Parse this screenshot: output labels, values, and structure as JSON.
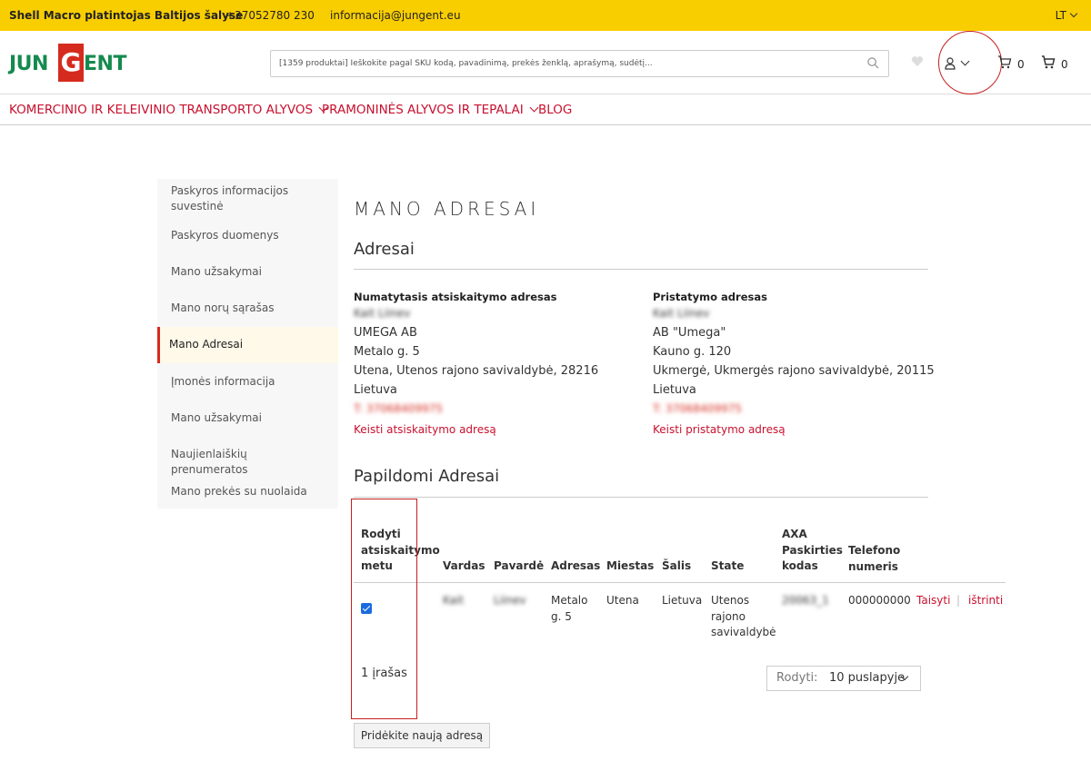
{
  "topbar": {
    "tagline": "Shell Macro platintojas Baltijos šalyse",
    "phone": "+37052780 230",
    "email": "informacija@jungent.eu",
    "language": "LT"
  },
  "header": {
    "logo": {
      "left": "JUN",
      "mid": "G",
      "right": "ENT"
    },
    "search_placeholder": "[1359 produktai] Ieškokite pagal SKU kodą, pavadinimą, prekės ženklą, aprašymą, sudėtį...",
    "compare_count": "0",
    "cart_count": "0"
  },
  "nav": {
    "items": [
      {
        "label": "KOMERCINIO IR KELEIVINIO TRANSPORTO ALYVOS"
      },
      {
        "label": "PRAMONINĖS ALYVOS IR TEPALAI"
      },
      {
        "label": "BLOG"
      }
    ]
  },
  "sidebar": {
    "items": [
      {
        "label": "Paskyros informacijos suvestinė"
      },
      {
        "label": "Paskyros duomenys"
      },
      {
        "label": "Mano užsakymai"
      },
      {
        "label": "Mano norų sąrašas"
      },
      {
        "label": "Mano Adresai"
      },
      {
        "label": "Įmonės informacija"
      },
      {
        "label": "Mano užsakymai"
      },
      {
        "label": "Naujienlaiškių prenumeratos"
      },
      {
        "label": "Mano prekės su nuolaida"
      }
    ]
  },
  "main": {
    "page_title": "MANO ADRESAI",
    "addresses_title": "Adresai",
    "billing": {
      "label": "Numatytasis atsiskaitymo adresas",
      "name": "Kait Liinev",
      "company": "UMEGA AB",
      "street": "Metalo g. 5",
      "city": "Utena, Utenos rajono savivaldybė, 28216",
      "country": "Lietuva",
      "phone": "T: 37068409975",
      "link": "Keisti atsiskaitymo adresą"
    },
    "shipping": {
      "label": "Pristatymo adresas",
      "name": "Kait Liinev",
      "company": "AB \"Umega\"",
      "street": "Kauno g. 120",
      "city": "Ukmergė, Ukmergės rajono savivaldybė, 20115",
      "country": "Lietuva",
      "phone": "T: 37068409975",
      "link": "Keisti pristatymo adresą"
    },
    "additional_title": "Papildomi Adresai",
    "table": {
      "headers": {
        "show": "Rodyti atsiskaitymo metu",
        "first": "Vardas",
        "last": "Pavardė",
        "address": "Adresas",
        "city": "Miestas",
        "country": "Šalis",
        "state": "State",
        "axa": "AXA Paskirties kodas",
        "phone": "Telefono numeris"
      },
      "row": {
        "first": "Kait",
        "last": "Liinev",
        "address": "Metalo g. 5",
        "city": "Utena",
        "country": "Lietuva",
        "state": "Utenos rajono savivaldybė",
        "axa": "20063_1",
        "phone": "000000000",
        "edit": "Taisyti",
        "sep": "|",
        "delete": "ištrinti"
      }
    },
    "record_count": "1 įrašas",
    "pager": {
      "label": "Rodyti:",
      "value": "10 puslapyje"
    },
    "add_button": "Pridėkite naują adresą"
  }
}
